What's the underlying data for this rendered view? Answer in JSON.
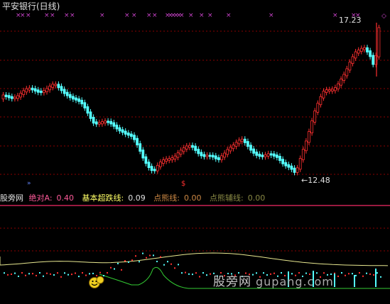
{
  "main_panel": {
    "title": "平安银行(日线)",
    "high_label": "17.23",
    "low_label": "←12.48",
    "signal_marker": "$"
  },
  "indicator_bar": {
    "name": "股旁网",
    "items": [
      {
        "label": "绝对A:",
        "value": "0.40",
        "color": "#ff5a9a"
      },
      {
        "label": "基本超跌线:",
        "value": "0.09",
        "color": "#ffff66"
      },
      {
        "label": "点熊线:",
        "value": "0.00",
        "color": "#cc8844"
      },
      {
        "label": "点熊辅线:",
        "value": "0.00",
        "color": "#888844"
      }
    ]
  },
  "watermark": {
    "cn": "股旁网",
    "url": "gupang.com"
  },
  "colors": {
    "background": "#000000",
    "up": "#ff3030",
    "down": "#54ffff",
    "grid": "#8b0000",
    "marker": "#cc44cc",
    "yellow_line": "#e8e890",
    "green_line": "#33cc33"
  }
}
